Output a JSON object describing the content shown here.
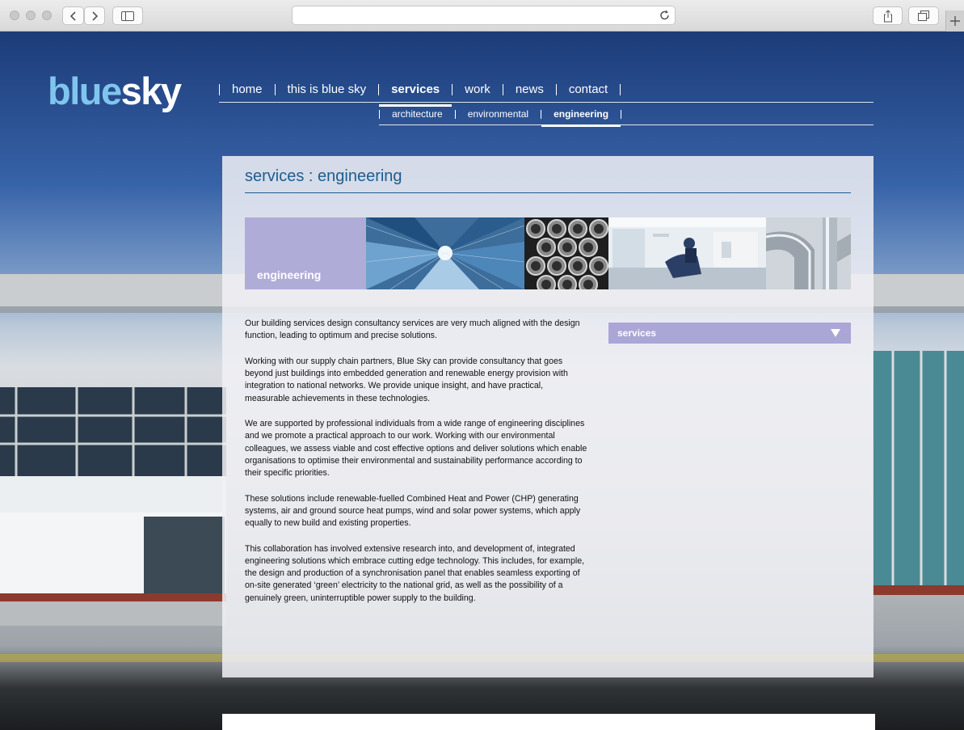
{
  "browser": {
    "url": ""
  },
  "logo": {
    "part1": "blue",
    "part2": "sky"
  },
  "nav": {
    "items": [
      {
        "label": "home",
        "active": false
      },
      {
        "label": "this is blue sky",
        "active": false
      },
      {
        "label": "services",
        "active": true
      },
      {
        "label": "work",
        "active": false
      },
      {
        "label": "news",
        "active": false
      },
      {
        "label": "contact",
        "active": false
      }
    ],
    "subitems": [
      {
        "label": "architecture",
        "active": false
      },
      {
        "label": "environmental",
        "active": false
      },
      {
        "label": "engineering",
        "active": true
      }
    ]
  },
  "content": {
    "title": "services : engineering",
    "banner_label": "engineering",
    "paragraphs": [
      "Our building services design consultancy services are very much aligned with the design function, leading to optimum and precise solutions.",
      "Working with our supply chain partners, Blue Sky can provide consultancy that goes beyond just buildings into embedded generation and renewable energy provision with integration to national networks. We provide unique insight, and have practical, measurable achievements in these technologies.",
      "We are supported by professional individuals from a wide range of engineering disciplines and we promote a practical approach to our work. Working with our environmental colleagues, we assess viable and cost effective options and deliver solutions which enable organisations to optimise their environmental and sustainability performance according to their specific priorities.",
      "These solutions include renewable-fuelled Combined Heat and Power (CHP) generating systems, air and ground source heat pumps, wind and solar power systems, which apply equally to new build and existing properties.",
      "This collaboration has involved extensive research into, and development of, integrated engineering solutions which embrace cutting edge technology. This includes, for example, the design and production of a synchronisation panel that enables seamless exporting of on-site generated ‘green’ electricity to the national grid, as well as the possibility of a genuinely green, uninterruptible power supply to the building."
    ],
    "dropdown_label": "services"
  },
  "colors": {
    "accent": "#1d5d8f",
    "lavender": "#aaa6d6",
    "logo_light": "#7fc6ef"
  }
}
